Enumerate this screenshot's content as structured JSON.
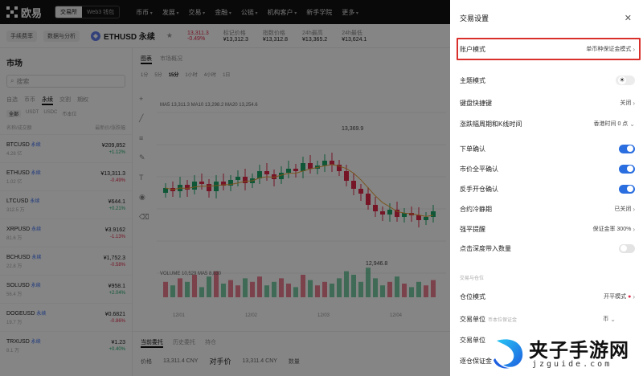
{
  "app": {
    "brand": "欧易",
    "mode_tabs": [
      "交易所",
      "Web3 钱包"
    ],
    "nav": [
      "币币",
      "发展",
      "交易",
      "金融",
      "公链",
      "机构客户",
      "新手学院",
      "更多"
    ]
  },
  "ticker": {
    "chips": [
      "手续费率",
      "数据与分析"
    ],
    "symbol": "ETHUSD 永续",
    "last": "13,311.3",
    "change": "-0.49%",
    "stats": [
      {
        "label": "标记价格",
        "value": "¥13,312.3"
      },
      {
        "label": "指数价格",
        "value": "¥13,312.8"
      },
      {
        "label": "24h最高",
        "value": "¥13,365.2"
      },
      {
        "label": "24h最低",
        "value": "¥13,624.1"
      }
    ]
  },
  "market": {
    "title": "市场",
    "search_placeholder": "搜索",
    "tabs": [
      "自选",
      "币币",
      "永续",
      "交割",
      "期权"
    ],
    "subtabs": [
      "全部",
      "USDT",
      "USDC",
      "币本位"
    ],
    "headers": [
      "名称/成交额",
      "最新价/涨跌幅"
    ],
    "rows": [
      {
        "name": "BTCUSD",
        "tag": "永续",
        "sub": "4.28 亿",
        "price": "¥209,852",
        "chg": "+1.12%",
        "dir": "up"
      },
      {
        "name": "ETHUSD",
        "tag": "永续",
        "sub": "1.02 亿",
        "price": "¥13,311.3",
        "chg": "-0.49%",
        "dir": "down"
      },
      {
        "name": "LTCUSD",
        "tag": "永续",
        "sub": "312.5 万",
        "price": "¥644.1",
        "chg": "+0.21%",
        "dir": "up"
      },
      {
        "name": "XRPUSD",
        "tag": "永续",
        "sub": "81.6 万",
        "price": "¥3.9162",
        "chg": "-1.13%",
        "dir": "down"
      },
      {
        "name": "BCHUSD",
        "tag": "永续",
        "sub": "22.8 万",
        "price": "¥1,752.3",
        "chg": "-0.58%",
        "dir": "down"
      },
      {
        "name": "SOLUSD",
        "tag": "永续",
        "sub": "56.4 万",
        "price": "¥958.1",
        "chg": "+2.04%",
        "dir": "up"
      },
      {
        "name": "DOGEUSD",
        "tag": "永续",
        "sub": "19.7 万",
        "price": "¥0.6821",
        "chg": "-0.86%",
        "dir": "down"
      },
      {
        "name": "TRXUSD",
        "tag": "永续",
        "sub": "8.1 万",
        "price": "¥1.23",
        "chg": "+0.40%",
        "dir": "up"
      }
    ]
  },
  "chart": {
    "tabs": [
      "图表",
      "市场概况"
    ],
    "intervals": [
      "1分",
      "5分",
      "15分",
      "1小时",
      "4小时",
      "1日"
    ],
    "high_label": "13,369.9",
    "low_label": "12,946.8",
    "x_ticks": [
      "12/01",
      "12/02",
      "12/03",
      "12/04"
    ],
    "legend": "MA5 13,311.3  MA10 13,298.2  MA20 13,254.6",
    "vol_legend": "VOLUME  10,529  MA5 8,830",
    "bottom_tabs": [
      "当前委托",
      "历史委托",
      "持仓"
    ],
    "order_labels": [
      "价格",
      "13,311.4 CNY",
      "对手价",
      "13,311.4 CNY",
      "数量"
    ],
    "bar_labels": [
      "全仓",
      "10x"
    ],
    "foot_labels": [
      "ETH",
      "数量"
    ]
  },
  "settings": {
    "title": "交易设置",
    "account_mode": {
      "label": "账户模式",
      "value": "单币种保证金模式"
    },
    "theme": {
      "label": "主题模式"
    },
    "shortcuts": {
      "label": "键盘快捷键",
      "value": "关闭"
    },
    "timezone": {
      "label": "涨跌幅周期和K线时间",
      "value": "香港时间 0 点"
    },
    "order_confirm": {
      "label": "下单确认",
      "on": true
    },
    "market_close_confirm": {
      "label": "市价全平确认",
      "on": true
    },
    "reverse_confirm": {
      "label": "反手开仓确认",
      "on": true
    },
    "cooldown": {
      "label": "合约冷静期",
      "value": "已关闭"
    },
    "liq_warning": {
      "label": "强平提醒",
      "value": "保证金率 300%"
    },
    "depth_click": {
      "label": "点击深度带入数量",
      "on": false
    },
    "section": "交易与仓位",
    "position_mode": {
      "label": "仓位模式",
      "value": "开平模式"
    },
    "trade_unit": {
      "label": "交易单位",
      "hint": "币本位保证金",
      "value": "币"
    },
    "trade_unit2": {
      "label": "交易单位"
    },
    "margin_mode": {
      "label": "逐仓保证金"
    }
  },
  "watermark": {
    "title": "夹子手游网",
    "url": "jzguide.com"
  },
  "colors": {
    "accent_blue": "#2a6ee0",
    "up": "#20a86b",
    "down": "#e0294a",
    "highlight": "#d9302c"
  }
}
